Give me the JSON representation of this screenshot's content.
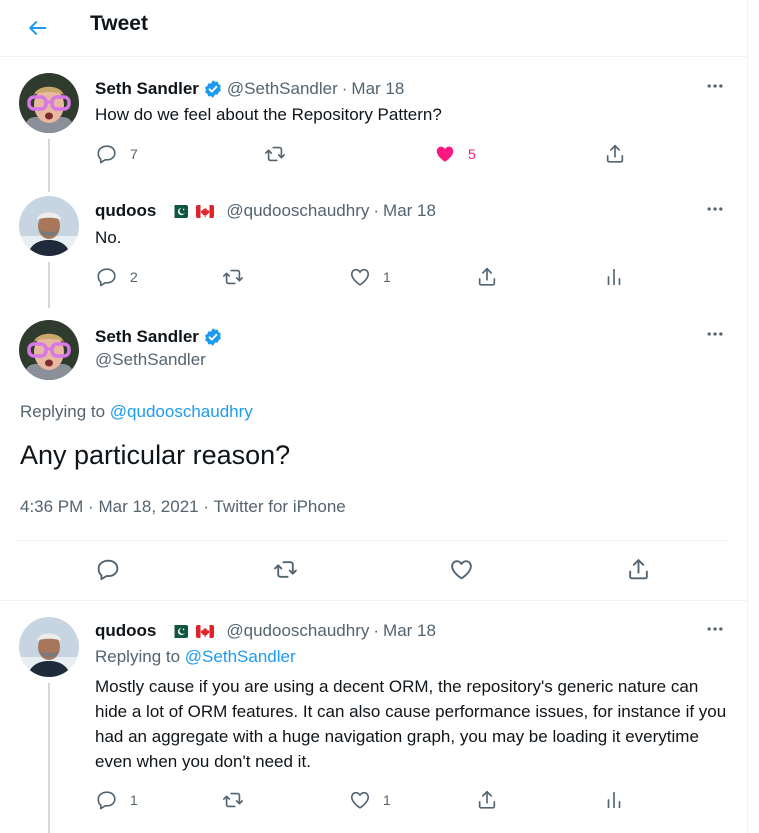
{
  "header": {
    "title": "Tweet"
  },
  "tweet1": {
    "name": "Seth Sandler",
    "handle": "@SethSandler",
    "sep": "·",
    "date": "Mar 18",
    "text": "How do we feel about the Repository Pattern?",
    "replies": "7",
    "likes": "5",
    "liked": true
  },
  "tweet2": {
    "name": "qudoos",
    "handle": "@qudooschaudhry",
    "sep": "·",
    "date": "Mar 18",
    "text": "No.",
    "replies": "2",
    "likes": "1"
  },
  "main": {
    "name": "Seth Sandler",
    "handle": "@SethSandler",
    "replying_prefix": "Replying to",
    "replying_to": "@qudooschaudhry",
    "text": "Any particular reason?",
    "time": "4:36 PM",
    "sep": "·",
    "date": "Mar 18, 2021",
    "source": "Twitter for iPhone"
  },
  "tweet3": {
    "name": "qudoos",
    "handle": "@qudooschaudhry",
    "sep": "·",
    "date": "Mar 18",
    "replying_prefix": "Replying to",
    "replying_to": "@SethSandler",
    "text": "Mostly cause if you are using a decent ORM, the repository's generic nature can hide a lot of ORM features. It can also cause performance issues, for instance if you had an aggregate with a huge navigation graph, you may be loading it everytime even when you don't need it.",
    "replies": "1",
    "likes": "1"
  },
  "colors": {
    "accent": "#1d9bf0",
    "like": "#f91880",
    "muted": "#536471",
    "text": "#0f1419"
  },
  "icons": [
    "back-arrow-icon",
    "verified-badge-icon",
    "more-icon",
    "reply-icon",
    "retweet-icon",
    "like-icon",
    "share-icon",
    "analytics-icon",
    "pakistan-flag-icon",
    "canada-flag-icon"
  ]
}
